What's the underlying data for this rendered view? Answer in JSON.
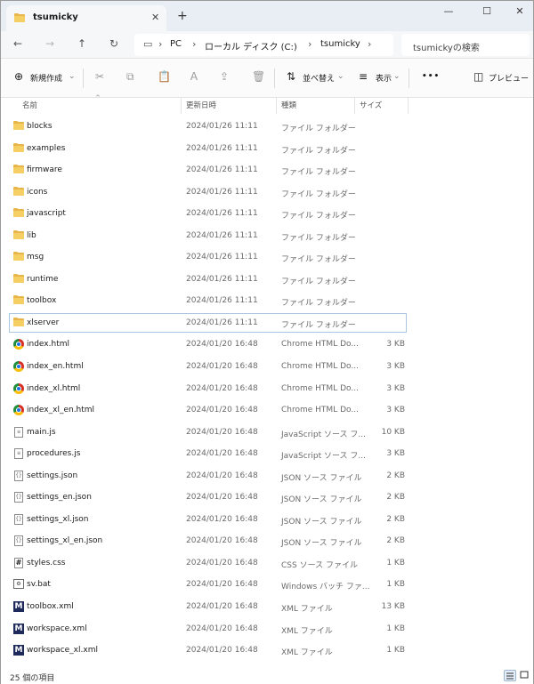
{
  "window": {
    "tab_title": "tsumicky",
    "tab_close": "✕",
    "tab_add": "+",
    "minimize": "—",
    "maximize": "☐",
    "close": "✕"
  },
  "nav": {
    "breadcrumb": [
      "PC",
      "ローカル ディスク (C:)",
      "tsumicky"
    ],
    "search_placeholder": "tsumickyの検索"
  },
  "commands": {
    "new": "新規作成",
    "sort": "並べ替え",
    "view": "表示",
    "more": "•••",
    "preview": "プレビュー"
  },
  "columns": {
    "name": "名前",
    "modified": "更新日時",
    "type": "種類",
    "size": "サイズ"
  },
  "files": [
    {
      "name": "blocks",
      "modified": "2024/01/26 11:11",
      "type": "ファイル フォルダー",
      "size": "",
      "icon": "folder-icon"
    },
    {
      "name": "examples",
      "modified": "2024/01/26 11:11",
      "type": "ファイル フォルダー",
      "size": "",
      "icon": "folder-icon"
    },
    {
      "name": "firmware",
      "modified": "2024/01/26 11:11",
      "type": "ファイル フォルダー",
      "size": "",
      "icon": "folder-icon"
    },
    {
      "name": "icons",
      "modified": "2024/01/26 11:11",
      "type": "ファイル フォルダー",
      "size": "",
      "icon": "folder-icon"
    },
    {
      "name": "javascript",
      "modified": "2024/01/26 11:11",
      "type": "ファイル フォルダー",
      "size": "",
      "icon": "folder-icon"
    },
    {
      "name": "lib",
      "modified": "2024/01/26 11:11",
      "type": "ファイル フォルダー",
      "size": "",
      "icon": "folder-icon"
    },
    {
      "name": "msg",
      "modified": "2024/01/26 11:11",
      "type": "ファイル フォルダー",
      "size": "",
      "icon": "folder-icon"
    },
    {
      "name": "runtime",
      "modified": "2024/01/26 11:11",
      "type": "ファイル フォルダー",
      "size": "",
      "icon": "folder-icon"
    },
    {
      "name": "toolbox",
      "modified": "2024/01/26 11:11",
      "type": "ファイル フォルダー",
      "size": "",
      "icon": "folder-icon"
    },
    {
      "name": "xlserver",
      "modified": "2024/01/26 11:11",
      "type": "ファイル フォルダー",
      "size": "",
      "icon": "folder-icon",
      "selected": true
    },
    {
      "name": "index.html",
      "modified": "2024/01/20 16:48",
      "type": "Chrome HTML Do...",
      "size": "3 KB",
      "icon": "chrome-icon"
    },
    {
      "name": "index_en.html",
      "modified": "2024/01/20 16:48",
      "type": "Chrome HTML Do...",
      "size": "3 KB",
      "icon": "chrome-icon"
    },
    {
      "name": "index_xl.html",
      "modified": "2024/01/20 16:48",
      "type": "Chrome HTML Do...",
      "size": "3 KB",
      "icon": "chrome-icon"
    },
    {
      "name": "index_xl_en.html",
      "modified": "2024/01/20 16:48",
      "type": "Chrome HTML Do...",
      "size": "3 KB",
      "icon": "chrome-icon"
    },
    {
      "name": "main.js",
      "modified": "2024/01/20 16:48",
      "type": "JavaScript ソース フ...",
      "size": "10 KB",
      "icon": "js-file-icon"
    },
    {
      "name": "procedures.js",
      "modified": "2024/01/20 16:48",
      "type": "JavaScript ソース フ...",
      "size": "3 KB",
      "icon": "js-file-icon"
    },
    {
      "name": "settings.json",
      "modified": "2024/01/20 16:48",
      "type": "JSON ソース ファイル",
      "size": "2 KB",
      "icon": "json-file-icon"
    },
    {
      "name": "settings_en.json",
      "modified": "2024/01/20 16:48",
      "type": "JSON ソース ファイル",
      "size": "2 KB",
      "icon": "json-file-icon"
    },
    {
      "name": "settings_xl.json",
      "modified": "2024/01/20 16:48",
      "type": "JSON ソース ファイル",
      "size": "2 KB",
      "icon": "json-file-icon"
    },
    {
      "name": "settings_xl_en.json",
      "modified": "2024/01/20 16:48",
      "type": "JSON ソース ファイル",
      "size": "2 KB",
      "icon": "json-file-icon"
    },
    {
      "name": "styles.css",
      "modified": "2024/01/20 16:48",
      "type": "CSS ソース ファイル",
      "size": "1 KB",
      "icon": "css-file-icon"
    },
    {
      "name": "sv.bat",
      "modified": "2024/01/20 16:48",
      "type": "Windows バッチ ファ...",
      "size": "1 KB",
      "icon": "batch-file-icon"
    },
    {
      "name": "toolbox.xml",
      "modified": "2024/01/20 16:48",
      "type": "XML ファイル",
      "size": "13 KB",
      "icon": "xml-file-icon"
    },
    {
      "name": "workspace.xml",
      "modified": "2024/01/20 16:48",
      "type": "XML ファイル",
      "size": "1 KB",
      "icon": "xml-file-icon"
    },
    {
      "name": "workspace_xl.xml",
      "modified": "2024/01/20 16:48",
      "type": "XML ファイル",
      "size": "1 KB",
      "icon": "xml-file-icon"
    }
  ],
  "status": {
    "item_count": "25 個の項目"
  }
}
